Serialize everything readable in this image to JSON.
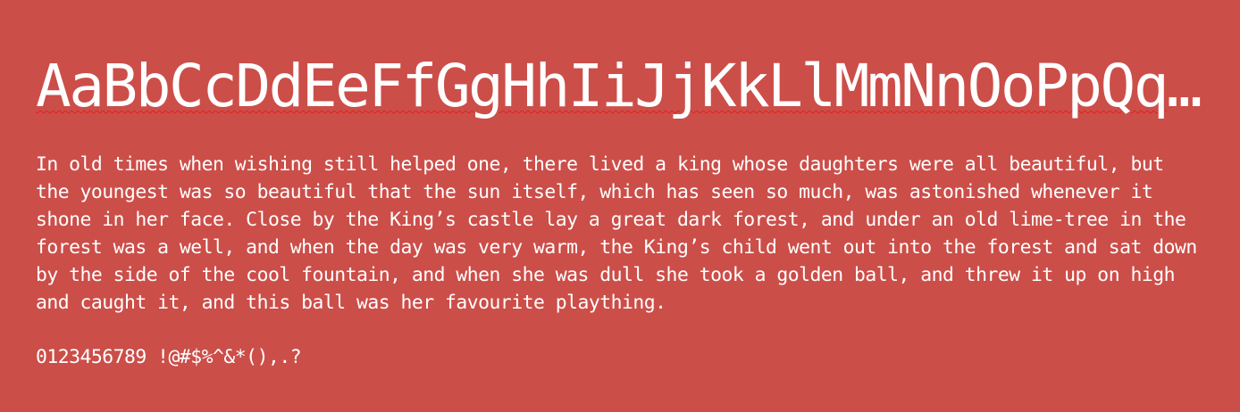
{
  "specimen": {
    "headline": "AaBbCcDdEeFfGgHhIiJjKkLlMmNnOoPpQqRrSsTtUuVvWwXxYyZz",
    "paragraph": "In old times when wishing still helped one, there lived a king whose daughters were all beautiful, but the youngest was so beautiful that the sun itself, which has seen so much, was astonished whenever it shone in her face. Close by the King’s castle lay a great dark forest, and under an old lime-tree in the forest was a well, and when the day was very warm, the King’s child went out into the forest and sat down by the side of the cool fountain, and when she was dull she took a golden ball, and threw it up on high and caught it, and this ball was her favourite plaything.",
    "charset": "0123456789 !@#$%^&*(),.?"
  },
  "colors": {
    "background": "#cc4e49",
    "text": "#ffffff",
    "spellcheck_underline": "#e61e1e"
  }
}
